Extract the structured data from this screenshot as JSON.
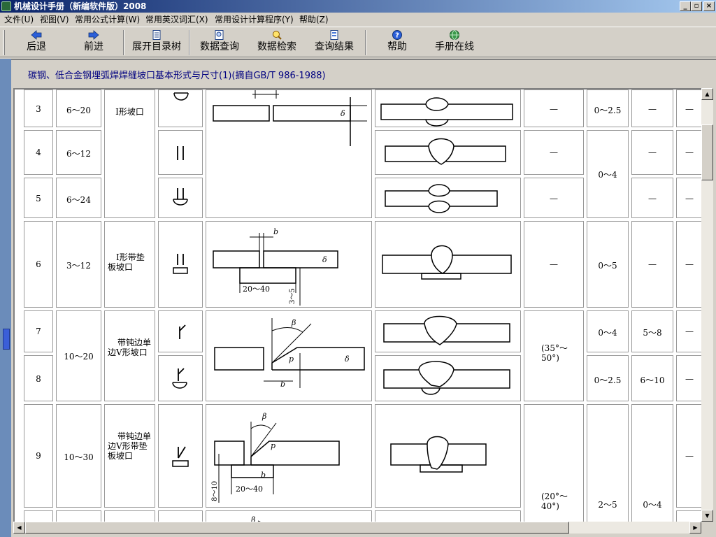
{
  "window": {
    "title": "机械设计手册（新编软件版）2008"
  },
  "menu": [
    "文件(U)",
    "视图(V)",
    "常用公式计算(W)",
    "常用英汉词汇(X)",
    "常用设计计算程序(Y)",
    "帮助(Z)"
  ],
  "toolbar": {
    "back": "后退",
    "forward": "前进",
    "expand_tree": "展开目录树",
    "data_query": "数据查询",
    "data_search": "数据检索",
    "query_results": "查询结果",
    "help": "帮助",
    "online": "手册在线"
  },
  "page": {
    "heading": "碳钢、低合金钢埋弧焊焊缝坡口基本形式与尺寸(1)(摘自GB/T 986-1988)"
  },
  "table": {
    "rows": [
      {
        "no": "3",
        "thickness": "6～20",
        "form": "I形坡口",
        "angle": "—",
        "gap": "0～2.5",
        "col8": "—",
        "col9": "—"
      },
      {
        "no": "4",
        "thickness": "6～12",
        "angle": "—",
        "col8": "—",
        "col9": "—"
      },
      {
        "no": "5",
        "thickness": "6～24",
        "angle": "—",
        "col8": "—",
        "col9": "—"
      },
      {
        "no": "6",
        "thickness": "3～12",
        "form": "I形带垫板坡口",
        "angle": "—",
        "gap": "0～5",
        "col8": "—",
        "col9": "—"
      },
      {
        "no": "7",
        "gap": "0～4",
        "col8": "5～8",
        "col9": "—"
      },
      {
        "no": "8",
        "gap": "0～2.5",
        "col8": "6～10",
        "col9": "—"
      },
      {
        "no": "9",
        "thickness": "10～30",
        "form": "带钝边单边V形带垫板坡口",
        "col9": "—"
      }
    ],
    "merged": {
      "gap_4_5": "0～4",
      "thickness_7_8": "10～20",
      "form_7_8": "带钝边单边V形坡口",
      "angle_7_8": "(35°～50°)",
      "angle_9": "(20°～40°)",
      "gap_9": "2～5",
      "col8_9": "0～4"
    },
    "drawing_labels": {
      "b": "b",
      "delta": "δ",
      "beta": "β",
      "p": "p",
      "backing_width": "20～40",
      "backing_thickness": "3～5",
      "backing_thickness_2": "8～10"
    }
  }
}
